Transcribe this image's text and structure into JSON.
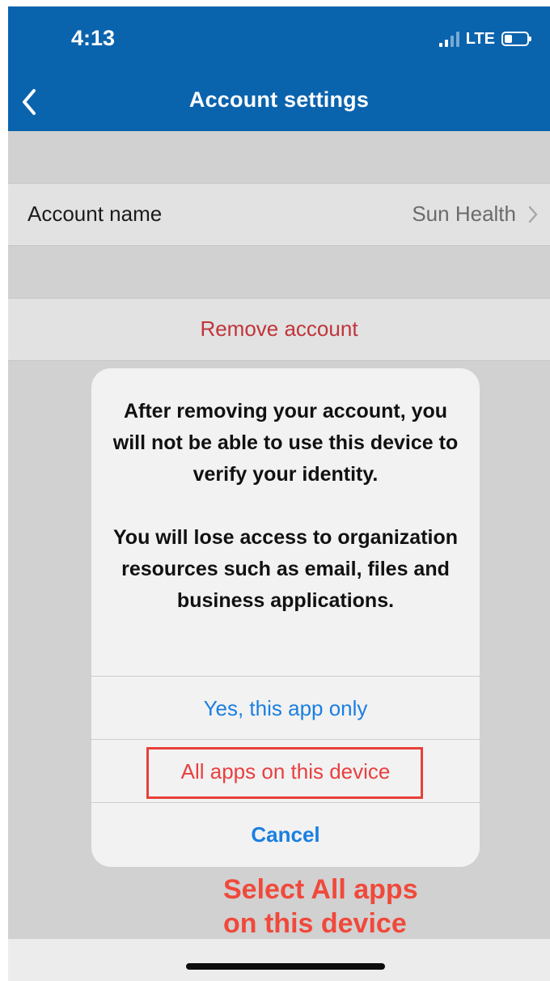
{
  "status_bar": {
    "time": "4:13",
    "network": "LTE"
  },
  "nav": {
    "title": "Account settings"
  },
  "account_row": {
    "label": "Account name",
    "value": "Sun Health"
  },
  "remove_row": {
    "label": "Remove account"
  },
  "alert": {
    "message_1": "After removing your account, you will not be able to use this device to verify your identity.",
    "message_2": "You will lose access to organization resources such as email, files and business applications.",
    "buttons": {
      "yes_this_app": "Yes, this app only",
      "all_apps": "All apps on this device",
      "cancel": "Cancel"
    }
  },
  "annotation": {
    "line_1": "Select All apps",
    "line_2": "on this device"
  },
  "colors": {
    "nav_bar": "#0a63ad",
    "destructive": "#c0343a",
    "alert_destructive": "#e84040",
    "action_blue": "#1a7fe0",
    "annotation": "#f0493b"
  }
}
